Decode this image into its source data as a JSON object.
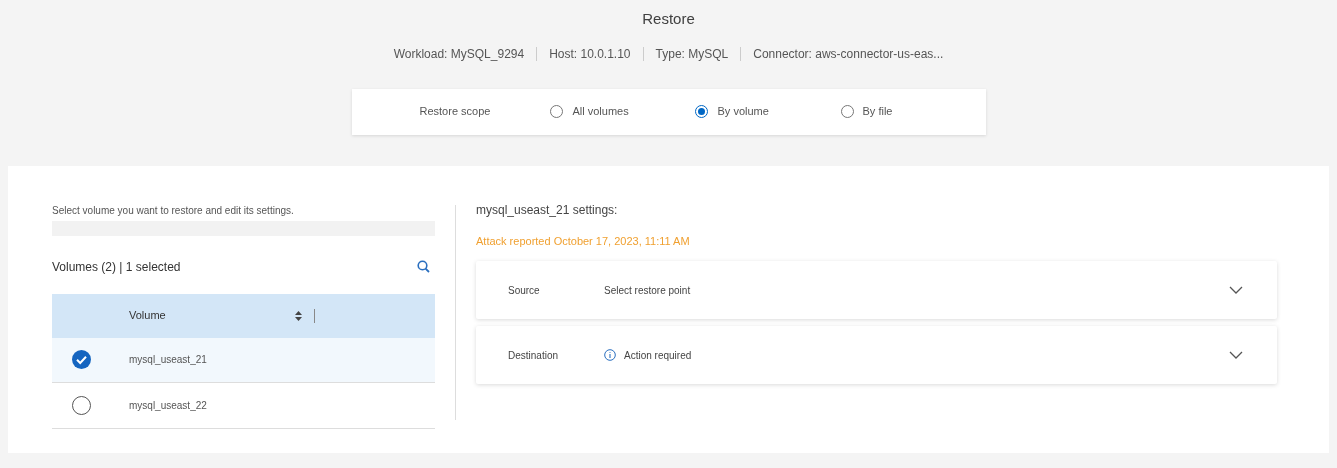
{
  "title": "Restore",
  "info": [
    "Workload: MySQL_9294",
    "Host: 10.0.1.10",
    "Type: MySQL",
    "Connector: aws-connector-us-eas..."
  ],
  "restore_scope": {
    "label": "Restore scope",
    "options": [
      {
        "label": "All volumes",
        "selected": false
      },
      {
        "label": "By volume",
        "selected": true
      },
      {
        "label": "By file",
        "selected": false
      }
    ]
  },
  "volumes": {
    "instruction": "Select volume you want to restore and edit its settings.",
    "heading": "Volumes (2) | 1 selected",
    "column": "Volume",
    "rows": [
      {
        "name": "mysql_useast_21",
        "selected": true
      },
      {
        "name": "mysql_useast_22",
        "selected": false
      }
    ]
  },
  "settings": {
    "title": "mysql_useast_21 settings:",
    "alert": "Attack reported October 17, 2023, 11:11 AM",
    "sections": [
      {
        "label": "Source",
        "value": "Select restore point",
        "kind": "plain",
        "expanded": false
      },
      {
        "label": "Destination",
        "value": "Action required",
        "kind": "info",
        "expanded": false
      }
    ]
  }
}
